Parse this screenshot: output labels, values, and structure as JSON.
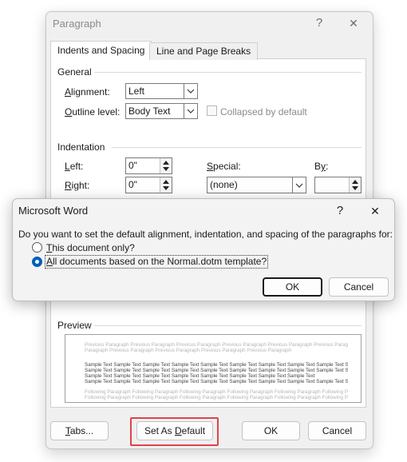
{
  "paragraph_dialog": {
    "title": "Paragraph",
    "help_glyph": "?",
    "close_glyph": "✕",
    "tabs": [
      {
        "label": "Indents and Spacing",
        "active": true
      },
      {
        "label": "Line and Page Breaks",
        "active": false
      }
    ],
    "general": {
      "title": "General",
      "alignment_label": "Alignment:",
      "alignment_value": "Left",
      "outline_label": "Outline level:",
      "outline_value": "Body Text",
      "collapsed_label": "Collapsed by default"
    },
    "indentation": {
      "title": "Indentation",
      "left_label": "Left:",
      "left_value": "0\"",
      "right_label": "Right:",
      "right_value": "0\"",
      "special_label": "Special:",
      "special_value": "(none)",
      "by_label": "By:",
      "by_value": ""
    },
    "preview": {
      "title": "Preview",
      "previous_lines": [
        "Previous Paragraph Previous Paragraph Previous Paragraph Previous Paragraph Previous Paragraph Previous Paragraph Previous",
        "Paragraph Previous Paragraph Previous Paragraph Previous Paragraph Previous Paragraph"
      ],
      "sample_lines": [
        "Sample Text Sample Text Sample Text Sample Text Sample Text Sample Text Sample Text Sample Text Sample Text Sample Text",
        "Sample Text Sample Text Sample Text Sample Text Sample Text Sample Text Sample Text Sample Text Sample Text Sample Text",
        "Sample Text Sample Text Sample Text Sample Text Sample Text Sample Text Sample Text Sample Text",
        "Sample Text Sample Text Sample Text Sample Text Sample Text Sample Text Sample Text Sample Text Sample Text Sample Text"
      ],
      "following_lines": [
        "Following Paragraph Following Paragraph Following Paragraph Following Paragraph Following Paragraph Following Paragraph",
        "Following Paragraph Following Paragraph Following Paragraph Following Paragraph Following Paragraph Following Paragraph"
      ]
    },
    "buttons": {
      "tabs": "Tabs...",
      "set_default": "Set As Default",
      "ok": "OK",
      "cancel": "Cancel"
    }
  },
  "word_dialog": {
    "title": "Microsoft Word",
    "help_glyph": "?",
    "close_glyph": "✕",
    "question": "Do you want to set the default alignment, indentation, and spacing of the paragraphs for:",
    "options": [
      {
        "label": "This document only?",
        "selected": false
      },
      {
        "label": "All documents based on the Normal.dotm template?",
        "selected": true
      }
    ],
    "ok": "OK",
    "cancel": "Cancel"
  },
  "colors": {
    "highlight": "#e0424b",
    "accent": "#005fb8"
  }
}
